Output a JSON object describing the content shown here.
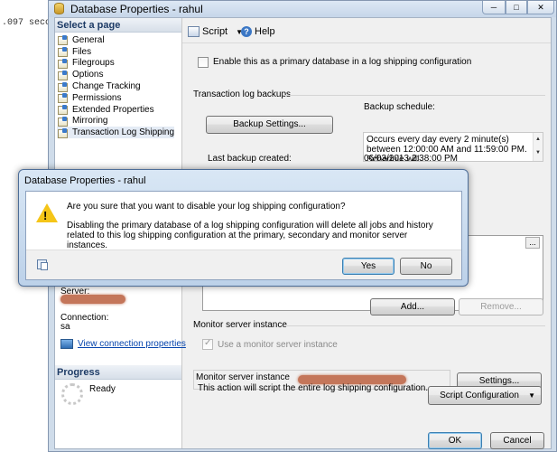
{
  "background": {
    "console_text": ".097 seco"
  },
  "window": {
    "title": "Database Properties - rahul",
    "min_glyph": "─",
    "max_glyph": "□",
    "close_glyph": "✕"
  },
  "left_panel": {
    "select_page_label": "Select a page",
    "pages": [
      "General",
      "Files",
      "Filegroups",
      "Options",
      "Change Tracking",
      "Permissions",
      "Extended Properties",
      "Mirroring",
      "Transaction Log Shipping"
    ],
    "selected_page": "Transaction Log Shipping",
    "server_label": "Server:",
    "connection_label": "Connection:",
    "connection_value": "sa",
    "view_connection_link": "View connection properties",
    "progress_label": "Progress",
    "progress_status": "Ready"
  },
  "toolbar": {
    "script_label": "Script",
    "help_label": "Help"
  },
  "main": {
    "enable_primary_label": "Enable this as a primary database in a log shipping configuration",
    "tlog_backups_label": "Transaction log backups",
    "backup_schedule_label": "Backup schedule:",
    "backup_settings_button": "Backup Settings...",
    "schedule_text": "Occurs every day every 2 minute(s) between 12:00:00 AM and 11:59:00 PM. Schedule will",
    "last_backup_label": "Last backup created:",
    "last_backup_value": "06/03/2013 2:38:00 PM",
    "add_button": "Add...",
    "remove_button": "Remove...",
    "monitor_section_label": "Monitor server instance",
    "use_monitor_label": "Use a monitor server instance",
    "monitor_instance_label": "Monitor server instance",
    "settings_button": "Settings...",
    "script_note": "This action will script the entire log shipping configuration.",
    "script_config_button": "Script Configuration",
    "ok_button": "OK",
    "cancel_button": "Cancel"
  },
  "dialog": {
    "title": "Database Properties - rahul",
    "question": "Are you sure that you want to disable your log shipping configuration?",
    "detail": "Disabling the primary database of a log shipping configuration will delete all jobs and history related to this log shipping configuration at the primary, secondary and monitor server instances.",
    "yes_button": "Yes",
    "no_button": "No"
  }
}
